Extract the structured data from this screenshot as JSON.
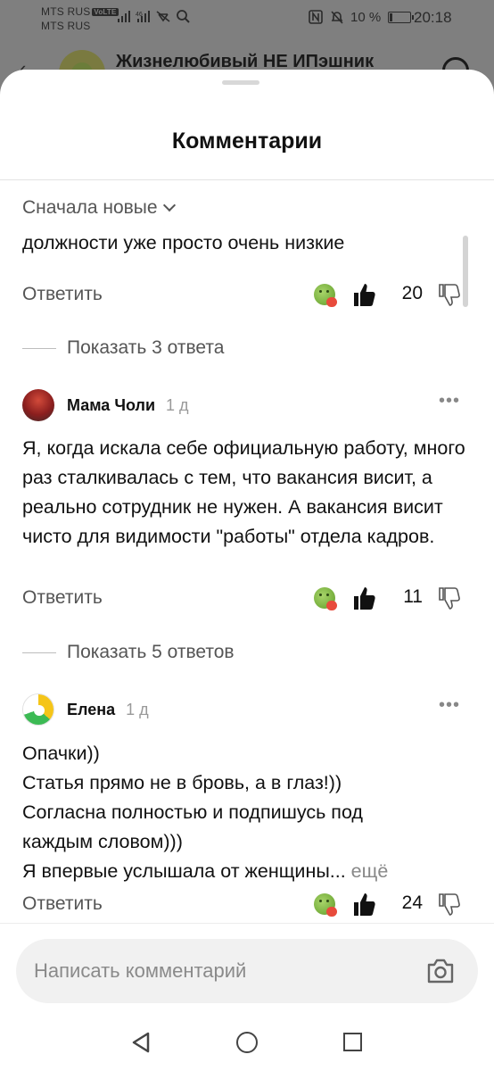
{
  "status_bar": {
    "operator_1": "MTS RUS",
    "operator_1_badge": "VoLTE",
    "operator_2": "MTS RUS",
    "signal_left": "📶 ⁴⁶📶 ⚡ 🔍",
    "battery_text": "10 %",
    "time": "20:18"
  },
  "background": {
    "channel_title": "Жизнелюбивый НЕ ИПэшник"
  },
  "sheet": {
    "title": "Комментарии",
    "sort_label": "Сначала новые"
  },
  "comments": [
    {
      "text_partial": "должности уже просто очень низкие",
      "reply_label": "Ответить",
      "likes": "20",
      "show_replies": "Показать 3 ответа"
    },
    {
      "author": "Мама Чоли",
      "time": "1 д",
      "text": "Я, когда искала себе официальную работу, много раз сталкивалась с тем, что вакансия висит, а реально сотрудник не нужен. А вакансия висит чисто для видимости \"работы\" отдела кадров.",
      "reply_label": "Ответить",
      "likes": "11",
      "show_replies": "Показать 5 ответов"
    },
    {
      "author": "Елена",
      "time": "1 д",
      "text_lines": [
        "Опачки))",
        "Статья прямо не в бровь, а в глаз!))",
        "Согласна полностью и подпишусь под",
        "каждым словом)))",
        "Я впервые услышала от женщины..."
      ],
      "more_label": "ещё",
      "reply_label": "Ответить",
      "likes": "24"
    }
  ],
  "input": {
    "placeholder": "Написать комментарий"
  },
  "icons": {
    "reaction": "emoji-reaction-icon",
    "like": "thumbs-up-icon",
    "dislike": "thumbs-down-icon",
    "camera": "camera-icon",
    "menu": "more-dots-icon"
  }
}
